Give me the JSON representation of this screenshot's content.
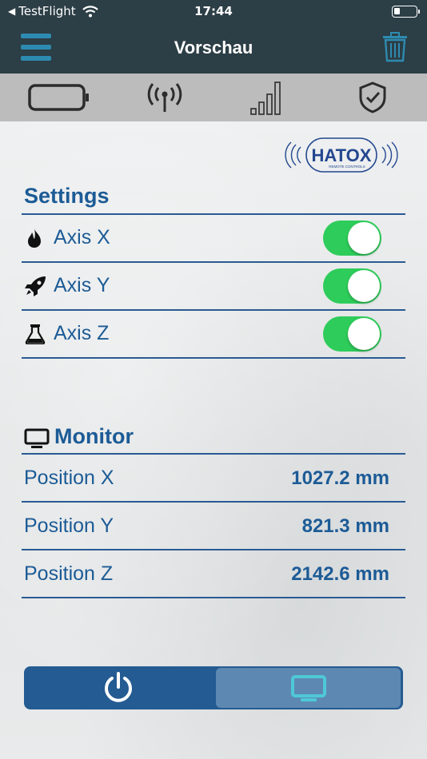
{
  "status_bar": {
    "back_app": "TestFlight",
    "time": "17:44"
  },
  "nav": {
    "title": "Vorschau"
  },
  "logo": {
    "brand": "HATOX",
    "tagline": "REMOTE CONTROLS"
  },
  "settings": {
    "title": "Settings",
    "items": [
      {
        "label": "Axis X",
        "icon": "fire-icon",
        "enabled": true
      },
      {
        "label": "Axis Y",
        "icon": "rocket-icon",
        "enabled": true
      },
      {
        "label": "Axis Z",
        "icon": "flask-icon",
        "enabled": true
      }
    ]
  },
  "monitor": {
    "title": "Monitor",
    "icon": "monitor-icon",
    "rows": [
      {
        "label": "Position X",
        "value": "1027.2 mm"
      },
      {
        "label": "Position Y",
        "value": "821.3 mm"
      },
      {
        "label": "Position Z",
        "value": "2142.6 mm"
      }
    ]
  },
  "bottom_bar": {
    "left_icon": "power-icon",
    "right_icon": "monitor-icon",
    "selected": "right"
  },
  "colors": {
    "nav_bg": "#2c3e46",
    "accent_blue": "#1c5b96",
    "toggle_on": "#2ecc5a",
    "segment_bg": "#245b92",
    "segment_selected": "#5d88b2",
    "segment_icon": "#4ec9d6"
  }
}
